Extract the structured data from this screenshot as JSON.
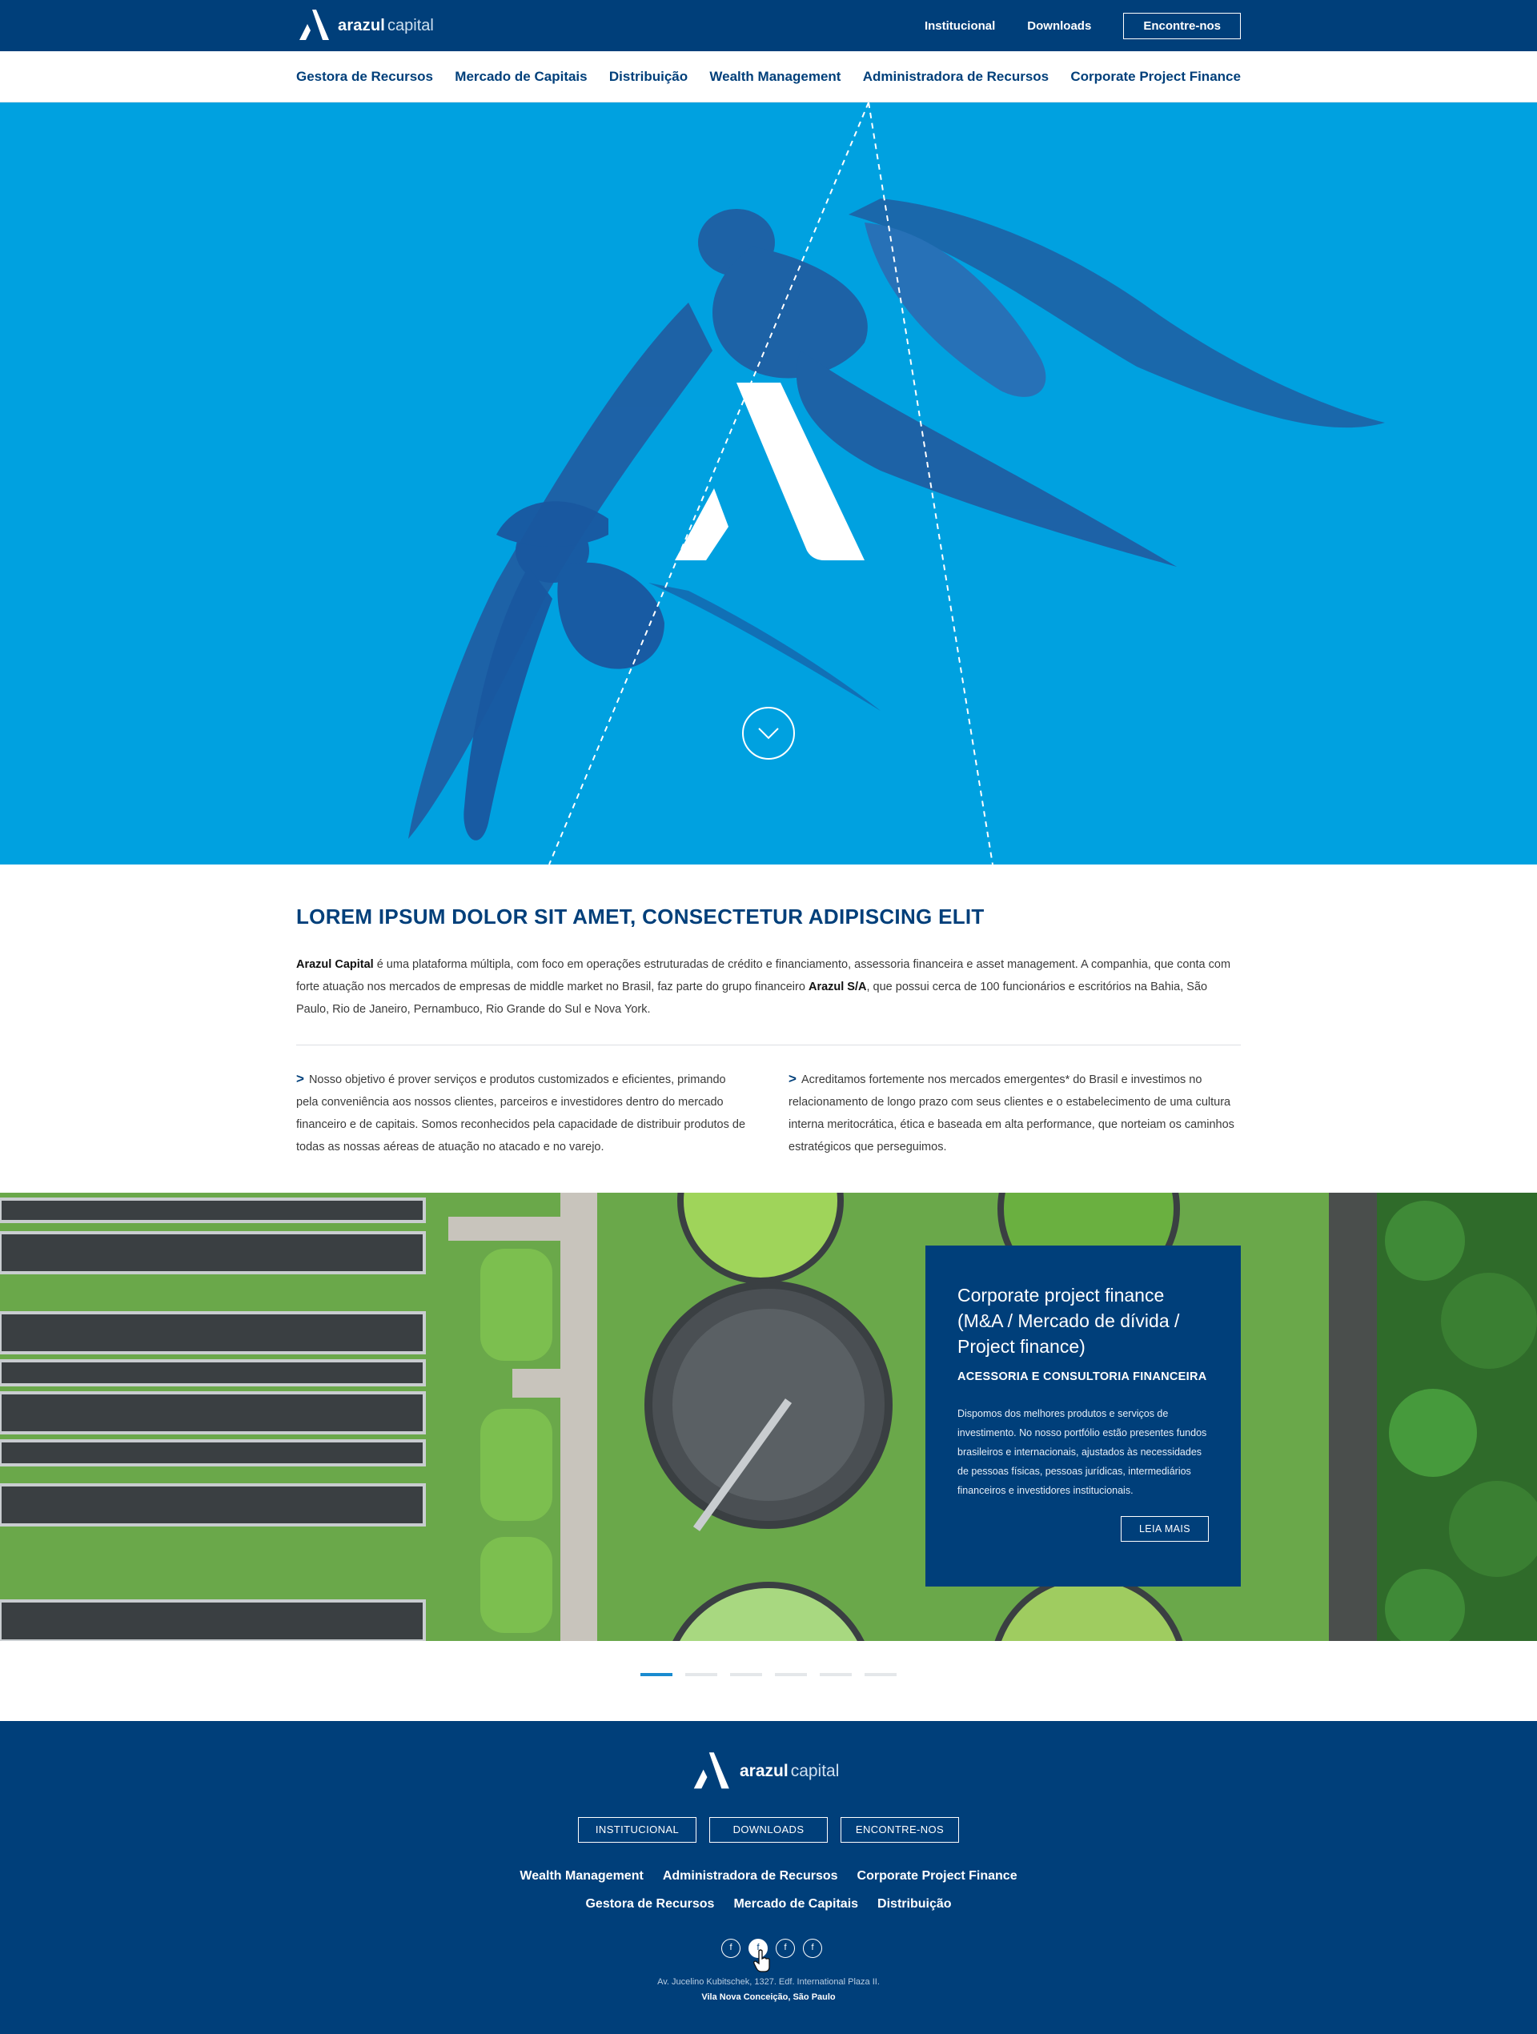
{
  "header": {
    "brand_bold": "arazul",
    "brand_light": "capital",
    "nav": [
      {
        "label": "Institucional"
      },
      {
        "label": "Downloads"
      },
      {
        "label": "Encontre-nos"
      }
    ]
  },
  "subnav": {
    "items": [
      {
        "label": "Gestora de Recursos"
      },
      {
        "label": "Mercado de Capitais"
      },
      {
        "label": "Distribuição"
      },
      {
        "label": "Wealth Management"
      },
      {
        "label": "Administradora de Recursos"
      },
      {
        "label": "Corporate Project Finance"
      }
    ]
  },
  "hero": {
    "scroll_icon": "chevron-down-icon"
  },
  "intro": {
    "title": "LOREM IPSUM DOLOR SIT AMET, CONSECTETUR ADIPISCING ELIT",
    "lead_bold_1": "Arazul Capital",
    "lead_text_1": " é uma plataforma múltipla, com foco em operações estruturadas de crédito e financiamento, assessoria financeira e asset management. A companhia, que conta com forte atuação nos mercados de empresas de middle market no Brasil, faz parte do grupo financeiro ",
    "lead_bold_2": "Arazul S/A",
    "lead_text_2": ", que possui cerca de 100 funcionários e escritórios na Bahia, São Paulo, Rio de Janeiro, Pernambuco, Rio Grande do Sul e Nova York.",
    "col_marker": ">",
    "col1": "Nosso objetivo é prover serviços e produtos customizados e eficientes, primando pela conveniência aos nossos clientes, parceiros e investidores dentro do mercado financeiro e de capitais. Somos reconhecidos pela capacidade de distribuir produtos de todas as nossas aéreas de atuação no atacado e no varejo.",
    "col2": "Acreditamos fortemente nos mercados emergentes* do Brasil e investimos no relacionamento de longo prazo com seus clientes e o estabelecimento de uma cultura interna meritocrática, ética e baseada em alta performance, que norteiam os caminhos estratégicos que perseguimos."
  },
  "feature": {
    "title": "Corporate project finance (M&A / Mercado de dívida / Project finance)",
    "subtitle": "ACESSORIA E CONSULTORIA FINANCEIRA",
    "body": "Dispomos dos melhores produtos e serviços de investimento. No nosso portfólio estão presentes fundos brasileiros e internacionais, ajustados às necessidades de pessoas físicas, pessoas jurídicas, intermediários financeiros e investidores institucionais.",
    "button": "LEIA MAIS"
  },
  "pager": {
    "count": 6,
    "active_index": 0
  },
  "footer": {
    "brand_bold": "arazul",
    "brand_light": "capital",
    "buttons": [
      {
        "label": "INSTITUCIONAL"
      },
      {
        "label": "DOWNLOADS"
      },
      {
        "label": "ENCONTRE-NOS"
      }
    ],
    "links_row1": [
      {
        "label": "Wealth Management"
      },
      {
        "label": "Administradora de Recursos"
      },
      {
        "label": "Corporate Project Finance"
      }
    ],
    "links_row2": [
      {
        "label": "Gestora de Recursos"
      },
      {
        "label": "Mercado de Capitais"
      },
      {
        "label": "Distribuição"
      }
    ],
    "social": [
      {
        "icon": "facebook-icon",
        "glyph": "f"
      },
      {
        "icon": "facebook-icon",
        "glyph": "f"
      },
      {
        "icon": "facebook-icon",
        "glyph": "f"
      },
      {
        "icon": "facebook-icon",
        "glyph": "f"
      }
    ],
    "address_line1": "Av. Jucelino Kubitschek, 1327. Edf. International Plaza II.",
    "address_line2": "Vila Nova Conceição, São Paulo"
  },
  "colors": {
    "navy": "#003f7a",
    "sky": "#00a1e0",
    "accent": "#1a8bd0"
  }
}
